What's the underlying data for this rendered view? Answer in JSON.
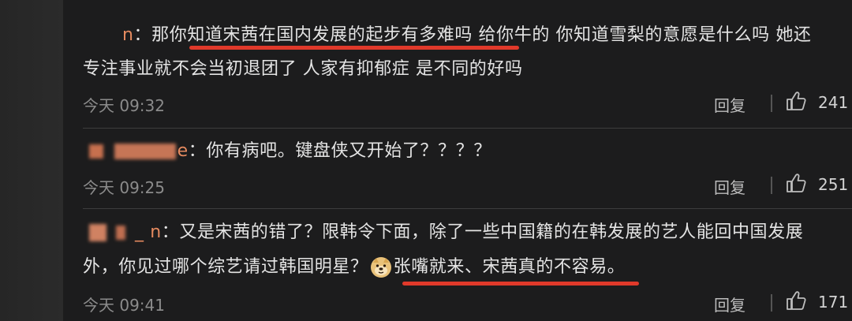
{
  "comments": [
    {
      "user_suffix": "n",
      "text_line1": "：那你知道宋茜在国内发展的起步有多难吗 给你牛的 你知道雪梨的意愿是什么吗 她还",
      "text_line2": "专注事业就不会当初退团了 人家有抑郁症 是不同的好吗",
      "time": "今天 09:32",
      "reply_label": "回复",
      "likes": "241"
    },
    {
      "user_suffix": "e",
      "text_line1": "：你有病吧。键盘侠又开始了？？？？",
      "time": "今天 09:25",
      "reply_label": "回复",
      "likes": "251"
    },
    {
      "user_prefix": "_ ",
      "user_suffix": "n",
      "text_line1": "：又是宋茜的错了？限韩令下面，除了一些中国籍的在韩发展的艺人能回中国发展",
      "text_line2_a": "外，你见过哪个综艺请过韩国明星？",
      "text_line2_b": "张嘴就来、宋茜真的不容易。",
      "time": "今天 09:41",
      "reply_label": "回复",
      "likes": "171"
    }
  ],
  "colors": {
    "background": "#1c1c1d",
    "username": "#e58a5f",
    "underline": "#e0392a",
    "meta": "#8b8b8b"
  },
  "icons": {
    "like": "thumbs-up-icon",
    "emoji": "doge-emoji-icon"
  }
}
